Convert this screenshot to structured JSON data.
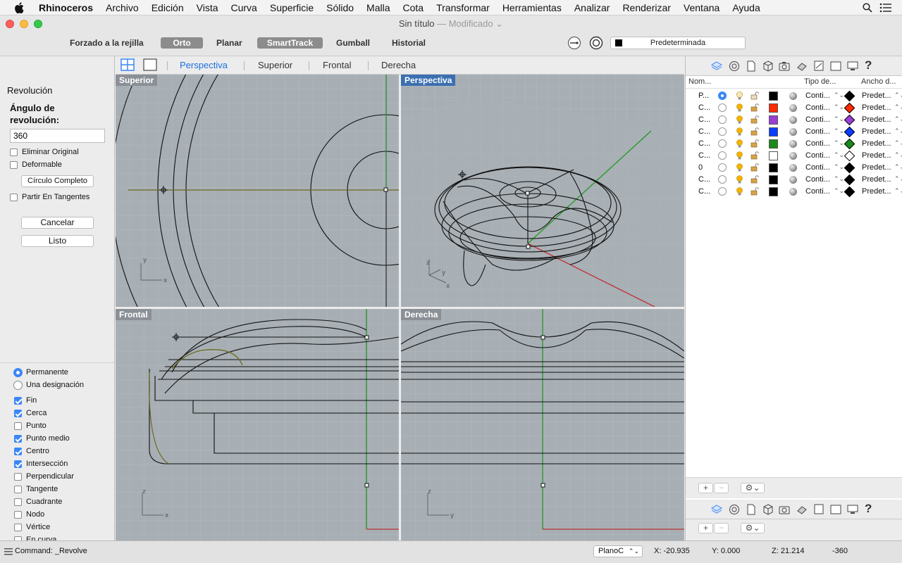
{
  "menubar": {
    "app_name": "Rhinoceros",
    "items": [
      "Archivo",
      "Edición",
      "Vista",
      "Curva",
      "Superficie",
      "Sólido",
      "Malla",
      "Cota",
      "Transformar",
      "Herramientas",
      "Analizar",
      "Renderizar",
      "Ventana",
      "Ayuda"
    ]
  },
  "window": {
    "title": "Sin título",
    "modified": "— Modificado"
  },
  "toolbar": {
    "grid_snap": "Forzado a la rejilla",
    "ortho": "Orto",
    "planar": "Planar",
    "smarttrack": "SmartTrack",
    "gumball": "Gumball",
    "history": "Historial",
    "layer": "Predeterminada"
  },
  "command_panel": {
    "title": "Revolución",
    "angle_label_1": "Ángulo de",
    "angle_label_2": "revolución:",
    "angle_value": "360",
    "delete_original": "Eliminar Original",
    "deformable": "Deformable",
    "full_circle": "Círculo Completo",
    "split_tangents": "Partir En Tangentes",
    "cancel": "Cancelar",
    "done": "Listo"
  },
  "osnap": {
    "permanent": "Permanente",
    "once": "Una designación",
    "items": [
      {
        "label": "Fin",
        "checked": true
      },
      {
        "label": "Cerca",
        "checked": true
      },
      {
        "label": "Punto",
        "checked": false
      },
      {
        "label": "Punto medio",
        "checked": true
      },
      {
        "label": "Centro",
        "checked": true
      },
      {
        "label": "Intersección",
        "checked": true
      },
      {
        "label": "Perpendicular",
        "checked": false
      },
      {
        "label": "Tangente",
        "checked": false
      },
      {
        "label": "Cuadrante",
        "checked": false
      },
      {
        "label": "Nodo",
        "checked": false
      },
      {
        "label": "Vértice",
        "checked": false
      },
      {
        "label": "En curva",
        "checked": false
      }
    ]
  },
  "viewport_tabs": [
    "Perspectiva",
    "Superior",
    "Frontal",
    "Derecha"
  ],
  "viewports": {
    "top": "Superior",
    "perspective": "Perspectiva",
    "front": "Frontal",
    "right": "Derecha"
  },
  "layers": {
    "headers": {
      "name": "Nom...",
      "linetype": "Tipo de...",
      "width": "Ancho d..."
    },
    "rows": [
      {
        "name": "P...",
        "current": true,
        "color": "#000000",
        "linetype": "Conti...",
        "width": "Predet...",
        "wcolor": "#000000"
      },
      {
        "name": "C...",
        "current": false,
        "color": "#ff2a00",
        "linetype": "Conti...",
        "width": "Predet...",
        "wcolor": "#ff2a00"
      },
      {
        "name": "C...",
        "current": false,
        "color": "#9b3ed6",
        "linetype": "Conti...",
        "width": "Predet...",
        "wcolor": "#9b3ed6"
      },
      {
        "name": "C...",
        "current": false,
        "color": "#0a3cff",
        "linetype": "Conti...",
        "width": "Predet...",
        "wcolor": "#0a3cff"
      },
      {
        "name": "C...",
        "current": false,
        "color": "#1a8a1a",
        "linetype": "Conti...",
        "width": "Predet...",
        "wcolor": "#1a8a1a"
      },
      {
        "name": "C...",
        "current": false,
        "color": "#ffffff",
        "linetype": "Conti...",
        "width": "Predet...",
        "wcolor": "#ffffff"
      },
      {
        "name": "0",
        "current": false,
        "color": "#000000",
        "linetype": "Conti...",
        "width": "Predet...",
        "wcolor": "#000000"
      },
      {
        "name": "C...",
        "current": false,
        "color": "#000000",
        "linetype": "Conti...",
        "width": "Predet...",
        "wcolor": "#000000"
      },
      {
        "name": "C...",
        "current": false,
        "color": "#000000",
        "linetype": "Conti...",
        "width": "Predet...",
        "wcolor": "#000000"
      }
    ]
  },
  "status": {
    "command": "Command: _Revolve",
    "cplane": "PlanoC",
    "x": "X: -20.935",
    "y": "Y: 0.000",
    "z": "Z: 21.214",
    "extra": "-360"
  }
}
